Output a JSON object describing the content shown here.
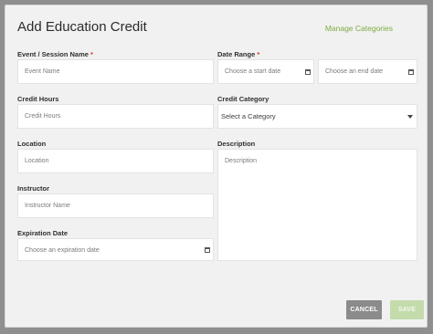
{
  "modal": {
    "title": "Add Education Credit",
    "manage_link": "Manage Categories",
    "required_marker": "*"
  },
  "fields": {
    "event": {
      "label": "Event / Session Name",
      "placeholder": "Event Name"
    },
    "date_range": {
      "label": "Date Range",
      "start_placeholder": "Choose a start date",
      "end_placeholder": "Choose an end date"
    },
    "credit_hours": {
      "label": "Credit Hours",
      "placeholder": "Credit Hours"
    },
    "credit_category": {
      "label": "Credit Category",
      "selected": "Select a Category"
    },
    "location": {
      "label": "Location",
      "placeholder": "Location"
    },
    "description": {
      "label": "Description",
      "placeholder": "Description"
    },
    "instructor": {
      "label": "Instructor",
      "placeholder": "Instructor Name"
    },
    "expiration_date": {
      "label": "Expiration Date",
      "placeholder": "Choose an expiration date"
    }
  },
  "buttons": {
    "cancel": "CANCEL",
    "save": "SAVE"
  },
  "colors": {
    "accent_link": "#7cac42",
    "required": "#d9362c",
    "cancel_bg": "#8b8b8b",
    "save_bg_disabled": "#c4dcac",
    "backdrop": "#8f8f8f"
  },
  "icons": {
    "calendar": "calendar-icon",
    "dropdown": "chevron-down-icon"
  }
}
